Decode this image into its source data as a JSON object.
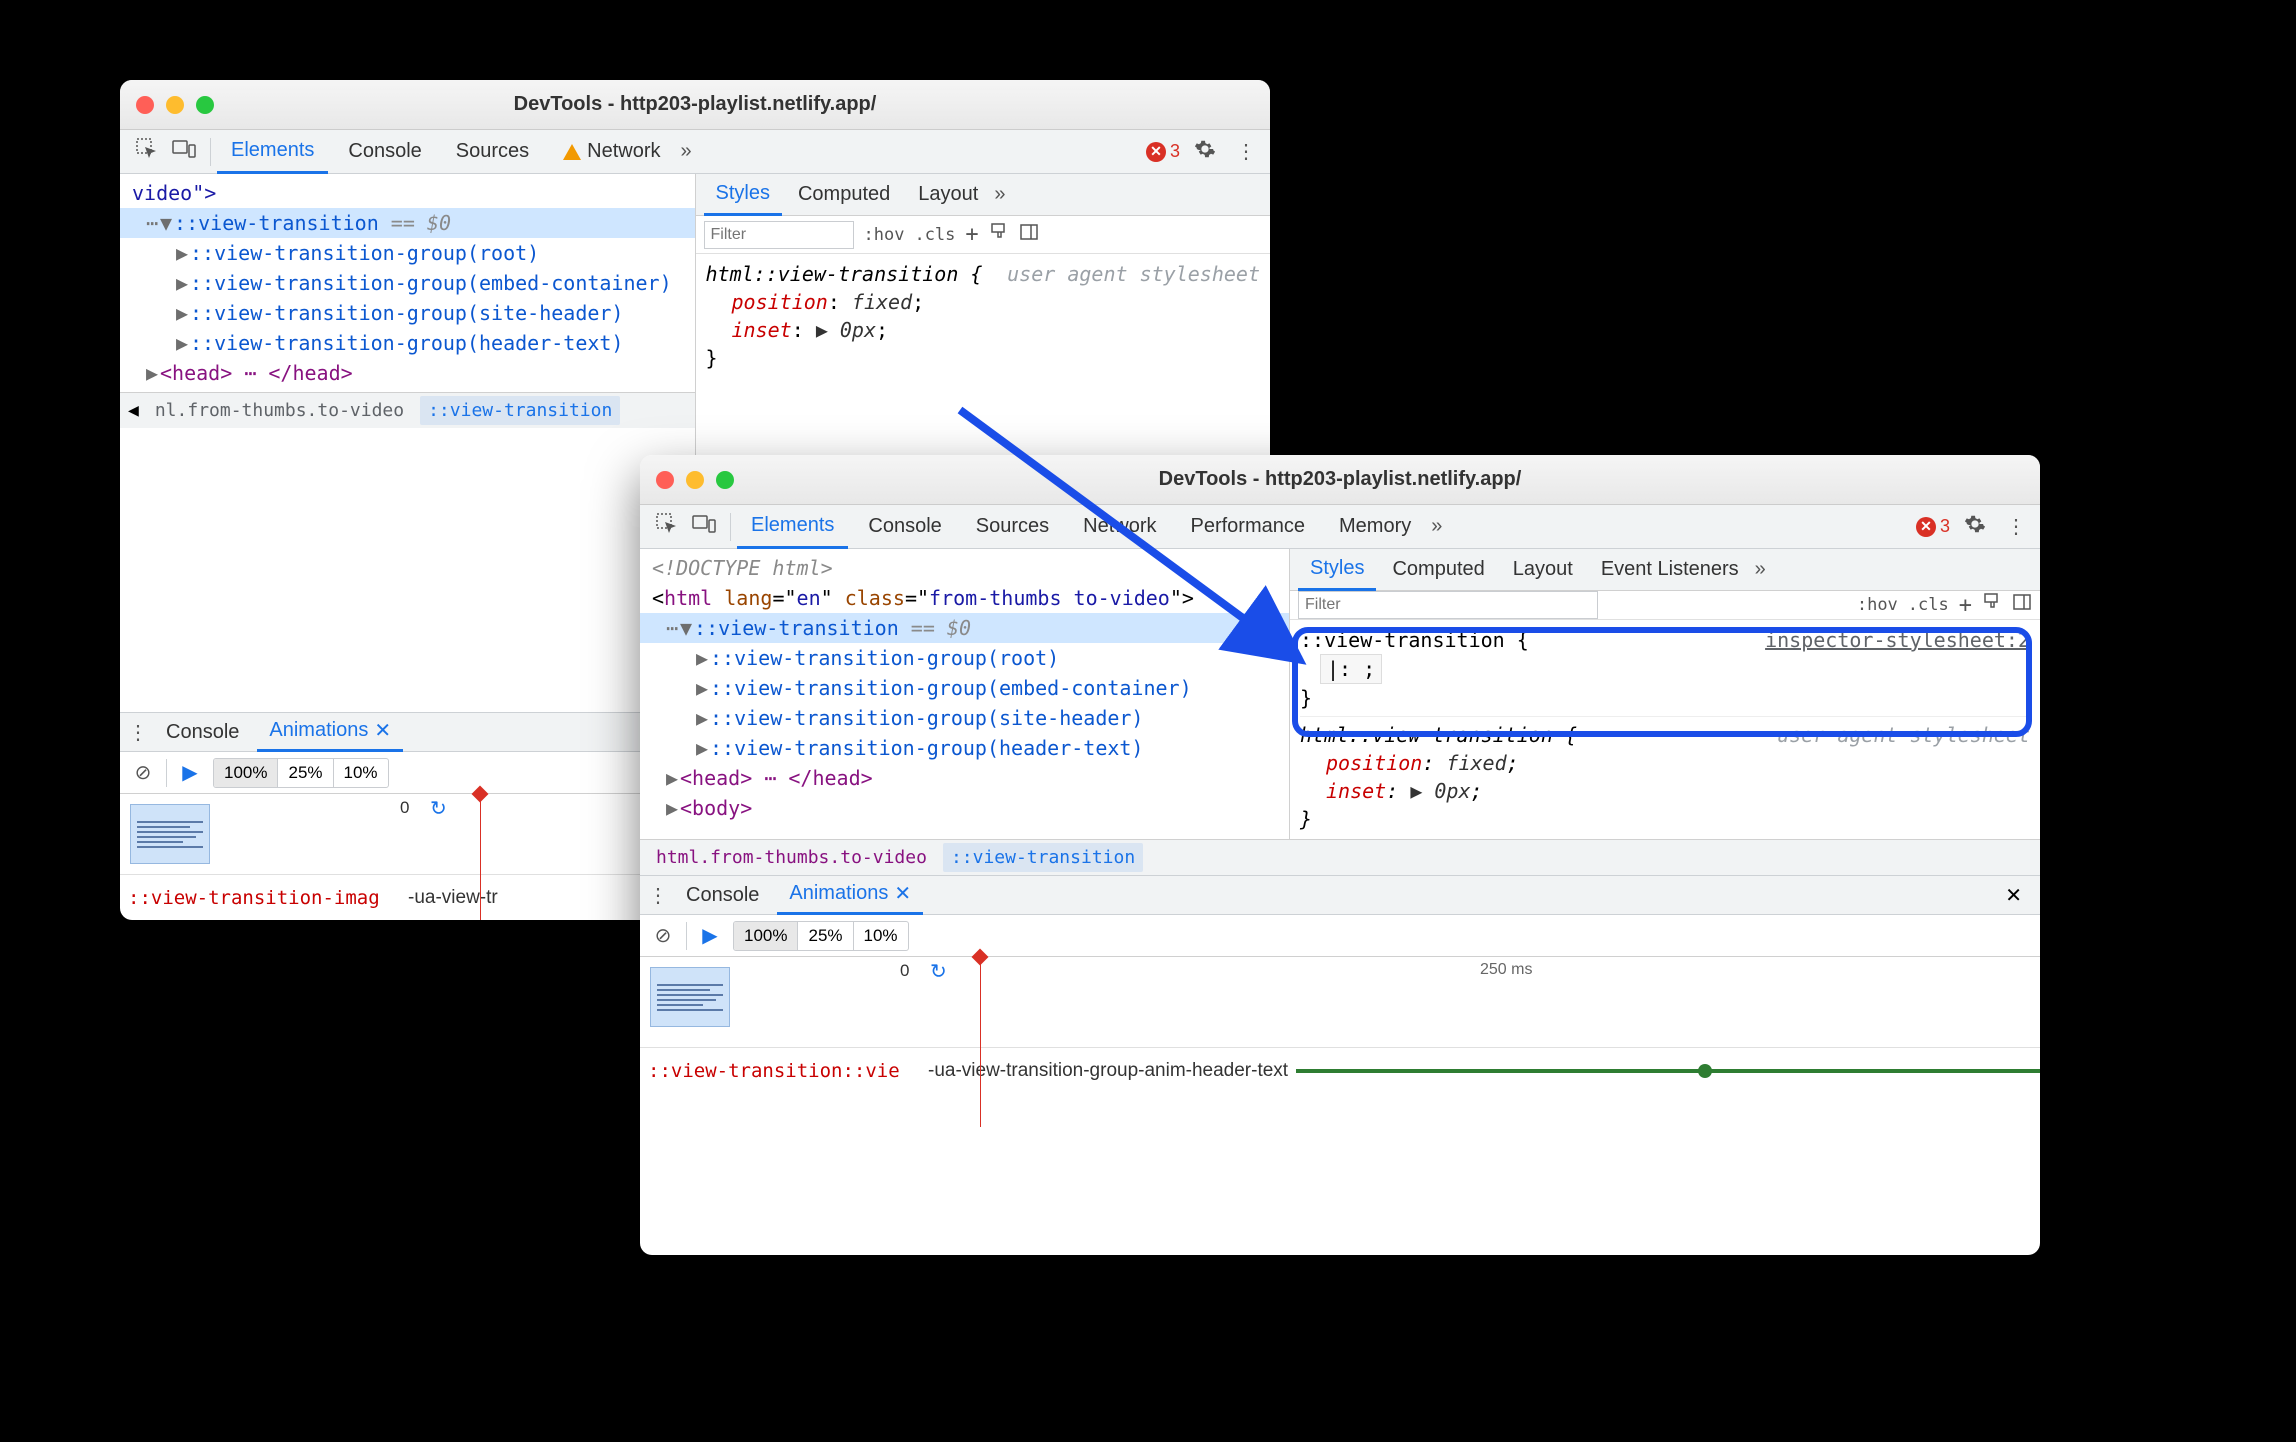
{
  "window1": {
    "title": "DevTools - http203-playlist.netlify.app/",
    "tabs": [
      "Elements",
      "Console",
      "Sources",
      "Network"
    ],
    "activeTab": "Elements",
    "errorCount": "3",
    "dom": {
      "line0": "video\">",
      "selected": "::view-transition",
      "selectedSuffix": " == $0",
      "groups": [
        "::view-transition-group(root)",
        "::view-transition-group(embed-container)",
        "::view-transition-group(site-header)",
        "::view-transition-group(header-text)"
      ],
      "headLine": "<head> ⋯ </head>"
    },
    "crumbs": {
      "left": "nl.from-thumbs.to-video",
      "right": "::view-transition"
    },
    "stylesTabs": [
      "Styles",
      "Computed",
      "Layout"
    ],
    "stylesActive": "Styles",
    "filterPlaceholder": "Filter",
    "toolbarBtns": {
      "hov": ":hov",
      "cls": ".cls",
      "plus": "+"
    },
    "rule": {
      "selector": "html::view-transition {",
      "source": "user agent stylesheet",
      "p1n": "position",
      "p1v": "fixed",
      "p2n": "inset",
      "p2v": "▶ 0px",
      "close": "}"
    },
    "drawerTabs": {
      "console": "Console",
      "animations": "Animations"
    },
    "speeds": [
      "100%",
      "25%",
      "10%"
    ],
    "timelineZero": "0",
    "trackLabel": "::view-transition-imag",
    "trackName": "-ua-view-tr"
  },
  "window2": {
    "title": "DevTools - http203-playlist.netlify.app/",
    "tabs": [
      "Elements",
      "Console",
      "Sources",
      "Network",
      "Performance",
      "Memory"
    ],
    "activeTab": "Elements",
    "errorCount": "3",
    "dom": {
      "doctype": "<!DOCTYPE html>",
      "htmlOpen": {
        "tag": "html",
        "lang": "en",
        "class": "from-thumbs to-video"
      },
      "selected": "::view-transition",
      "selectedSuffix": " == $0",
      "groups": [
        "::view-transition-group(root)",
        "::view-transition-group(embed-container)",
        "::view-transition-group(site-header)",
        "::view-transition-group(header-text)"
      ],
      "head": "<head> ⋯ </head>",
      "body": "<body>"
    },
    "crumbs": {
      "left": "html.from-thumbs.to-video",
      "right": "::view-transition"
    },
    "stylesTabs": [
      "Styles",
      "Computed",
      "Layout",
      "Event Listeners"
    ],
    "stylesActive": "Styles",
    "filterPlaceholder": "Filter",
    "toolbarBtns": {
      "hov": ":hov",
      "cls": ".cls",
      "plus": "+"
    },
    "newRule": {
      "selector": "::view-transition {",
      "source": "inspector-stylesheet:2",
      "editing": "|: ;",
      "close": "}"
    },
    "uaRule": {
      "selector": "html::view-transition {",
      "source": "user agent stylesheet",
      "p1n": "position",
      "p1v": "fixed",
      "p2n": "inset",
      "p2v": "▶ 0px",
      "close": "}"
    },
    "drawerTabs": {
      "console": "Console",
      "animations": "Animations"
    },
    "speeds": [
      "100%",
      "25%",
      "10%"
    ],
    "timelineZero": "0",
    "timelineMark": "250 ms",
    "trackLabel": "::view-transition::vie",
    "trackName": "-ua-view-transition-group-anim-header-text"
  }
}
